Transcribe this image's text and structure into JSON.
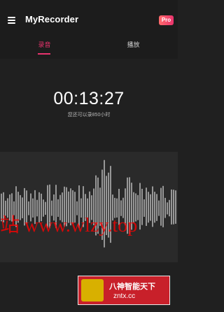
{
  "appbar": {
    "title": "MyRecorder",
    "badge": "Pro"
  },
  "tabs": [
    {
      "label": "录音",
      "selected": true
    },
    {
      "label": "播放",
      "selected": false
    }
  ],
  "recording": {
    "elapsed": "00:13:27",
    "remaining": "您还可以录850小时"
  },
  "overlay": {
    "watermark": "站 www.wlzy.top",
    "logo_cn": "八神智能天下",
    "logo_en": "zntx.cc"
  },
  "colors": {
    "accent": "#e8336d",
    "background": "#202020",
    "waveform": "#e0e0e0"
  }
}
